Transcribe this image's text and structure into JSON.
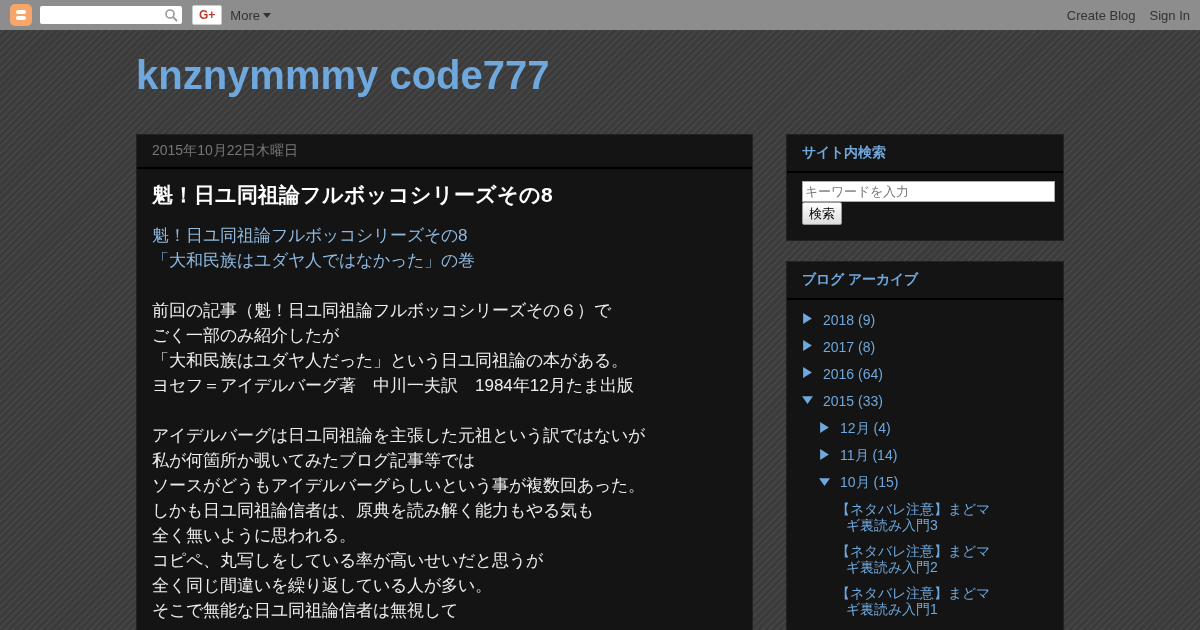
{
  "navbar": {
    "gplus": "G+",
    "more": "More",
    "links": [
      "Create Blog",
      "Sign In"
    ]
  },
  "blog_title": "knznymmmy code777",
  "post": {
    "date": "2015年10月22日木曜日",
    "title": "魁！日ユ同祖論フルボッコシリーズその8",
    "links": [
      "魁！日ユ同祖論フルボッコシリーズその8",
      "「大和民族はユダヤ人ではなかった」の巻"
    ],
    "paragraphs": [
      [
        "前回の記事（魁！日ユ同祖論フルボッコシリーズその６）で",
        "ごく一部のみ紹介したが",
        "「大和民族はユダヤ人だった」という日ユ同祖論の本がある。",
        "ヨセフ＝アイデルバーグ著　中川一夫訳　1984年12月たま出版"
      ],
      [
        "アイデルバーグは日ユ同祖論を主張した元祖という訳ではないが",
        "私が何箇所か覗いてみたブログ記事等では",
        "ソースがどうもアイデルバーグらしいという事が複数回あった。",
        "しかも日ユ同祖論信者は、原典を読み解く能力もやる気も",
        "全く無いように思われる。",
        "コピペ、丸写しをしている率が高いせいだと思うが",
        "全く同じ間違いを繰り返している人が多い。",
        "そこで無能な日ユ同祖論信者は無視して"
      ]
    ]
  },
  "sidebar": {
    "search_widget": {
      "title": "サイト内検索",
      "placeholder": "キーワードを入力",
      "button": "検索"
    },
    "archive": {
      "title": "ブログ アーカイブ",
      "years": [
        {
          "label": "2018",
          "count": "(9)",
          "expanded": false
        },
        {
          "label": "2017",
          "count": "(8)",
          "expanded": false
        },
        {
          "label": "2016",
          "count": "(64)",
          "expanded": false
        },
        {
          "label": "2015",
          "count": "(33)",
          "expanded": true,
          "children": [
            {
              "label": "12月",
              "count": "(4)",
              "expanded": false
            },
            {
              "label": "11月",
              "count": "(14)",
              "expanded": false
            },
            {
              "label": "10月",
              "count": "(15)",
              "expanded": true,
              "children": [
                {
                  "label": "【ネタバレ注意】まどマギ裏読み入門3"
                },
                {
                  "label": "【ネタバレ注意】まどマギ裏読み入門2"
                },
                {
                  "label": "【ネタバレ注意】まどマギ裏読み入門1"
                }
              ]
            }
          ]
        }
      ]
    }
  }
}
